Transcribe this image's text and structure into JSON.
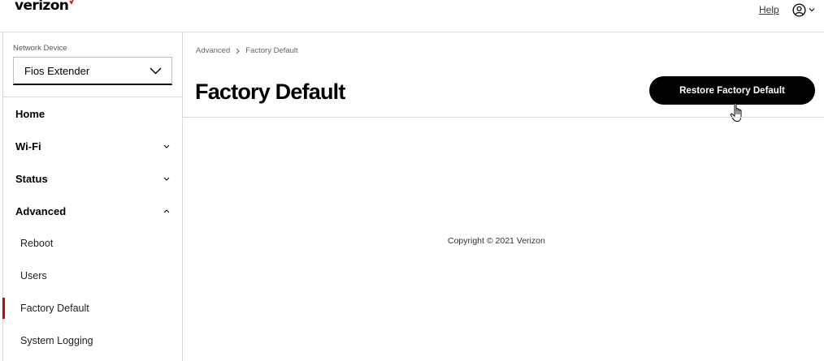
{
  "header": {
    "logo_text": "verizon",
    "help_label": "Help",
    "brand_color": "#cd040b"
  },
  "sidebar": {
    "device_label": "Network Device",
    "device_value": "Fios Extender",
    "items": [
      {
        "label": "Home"
      },
      {
        "label": "Wi-Fi"
      },
      {
        "label": "Status"
      },
      {
        "label": "Advanced"
      },
      {
        "label": "Reboot"
      },
      {
        "label": "Users"
      },
      {
        "label": "Factory Default"
      },
      {
        "label": "System Logging"
      }
    ]
  },
  "main": {
    "breadcrumb": [
      "Advanced",
      "Factory Default"
    ],
    "title": "Factory Default",
    "restore_label": "Restore Factory Default",
    "copyright": "Copyright © 2021 Verizon"
  }
}
